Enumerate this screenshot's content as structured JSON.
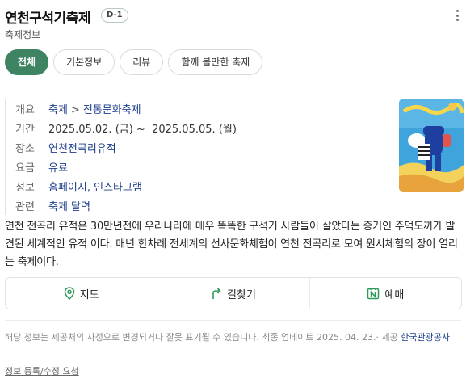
{
  "header": {
    "title": "연천구석기축제",
    "dday": "D-1",
    "subtitle": "축제정보"
  },
  "tabs": [
    {
      "label": "전체",
      "active": true
    },
    {
      "label": "기본정보",
      "active": false
    },
    {
      "label": "리뷰",
      "active": false
    },
    {
      "label": "함께 볼만한 축제",
      "active": false
    }
  ],
  "info": {
    "overview": {
      "label": "개요",
      "category": "축제",
      "separator": ">",
      "subcategory": "전통문화축제"
    },
    "period": {
      "label": "기간",
      "value": "2025.05.02. (금) ~  2025.05.05. (월)"
    },
    "place": {
      "label": "장소",
      "value": "연천전곡리유적"
    },
    "fee": {
      "label": "요금",
      "value": "유료"
    },
    "links": {
      "label": "정보",
      "value": "홈페이지, 인스타그램"
    },
    "related": {
      "label": "관련",
      "value": "축제 달력"
    }
  },
  "description": "연천 전곡리 유적은 30만년전에 우리나라에 매우 똑똑한 구석기 사람들이 살았다는 증거인 주먹도끼가 발견된 세계적인 유적 이다. 매년 한차례 전세계의 선사문화체험이 연천 전곡리로 모여 원시체험의 장이 열리는 축제이다.",
  "actions": {
    "map": "지도",
    "directions": "길찾기",
    "booking": "예매"
  },
  "footer": {
    "note": "해당 정보는 제공처의 사정으로 변경되거나 잘못 표기될 수 있습니다. 최종 업데이트 2025. 04. 23.· 제공",
    "provider": "한국관광공사",
    "report": "정보 등록/수정 요청"
  },
  "colors": {
    "accent": "#3e8463",
    "link": "#1f3f8c",
    "poster_bg": "#3fa3dc"
  }
}
